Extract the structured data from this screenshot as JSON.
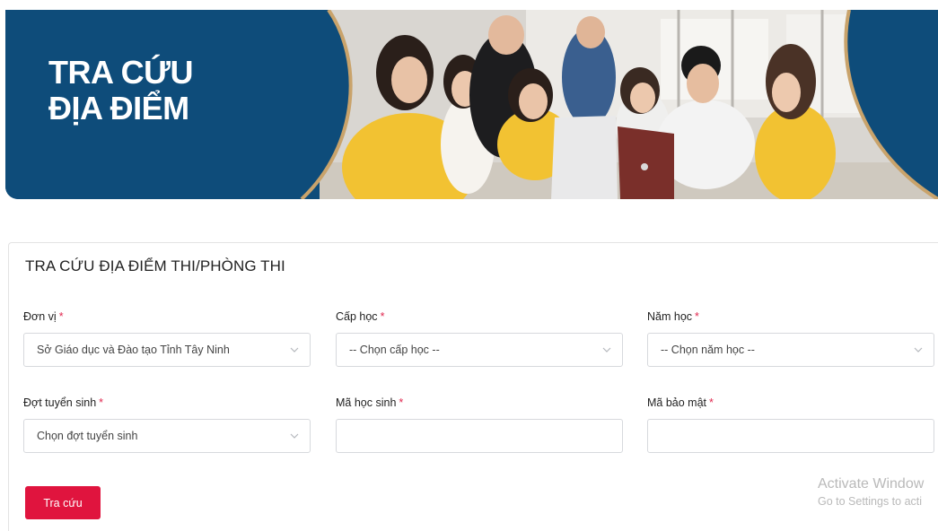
{
  "banner": {
    "title_line1": "TRA CỨU",
    "title_line2": "ĐỊA ĐIỂM",
    "brand_color": "#0e4c7a",
    "curve_color": "#c9a36b"
  },
  "form": {
    "title": "TRA CỨU ĐỊA ĐIỂM THI/PHÒNG THI",
    "required_mark": "*",
    "fields": {
      "don_vi": {
        "label": "Đơn vị",
        "value": "Sở Giáo dục và Đào tạo Tỉnh Tây Ninh"
      },
      "cap_hoc": {
        "label": "Cấp học",
        "value": "-- Chọn cấp học --"
      },
      "nam_hoc": {
        "label": "Năm học",
        "value": "-- Chọn năm học --"
      },
      "dot_tuyen_sinh": {
        "label": "Đợt tuyển sinh",
        "value": "Chọn đợt tuyển sinh"
      },
      "ma_hoc_sinh": {
        "label": "Mã học sinh",
        "value": ""
      },
      "ma_bao_mat": {
        "label": "Mã bảo mật",
        "value": ""
      }
    },
    "submit_label": "Tra cứu",
    "accent_color": "#e0143e"
  },
  "watermark": {
    "line1": "Activate Window",
    "line2": "Go to Settings to acti"
  }
}
